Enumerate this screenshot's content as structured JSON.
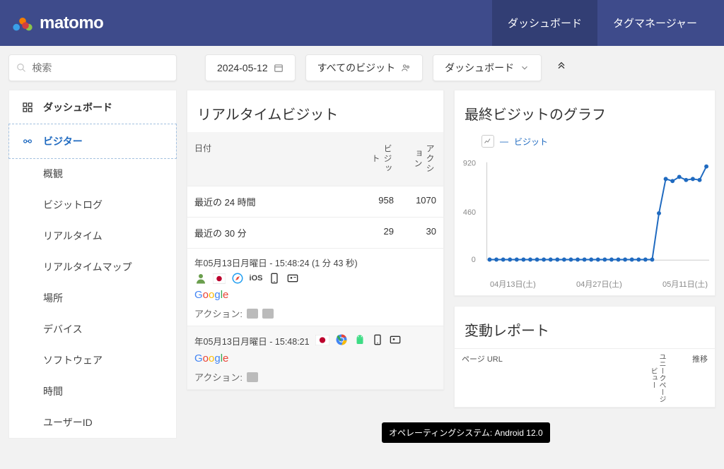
{
  "nav": {
    "logo_text": "matomo",
    "items": [
      "ダッシュボード",
      "タグマネージャー"
    ]
  },
  "toolbar": {
    "search_placeholder": "検索",
    "date": "2024-05-12",
    "segment": "すべてのビジット",
    "dashboard": "ダッシュボード"
  },
  "sidebar": {
    "dashboard": "ダッシュボード",
    "visitors": "ビジター",
    "subs": [
      "概観",
      "ビジットログ",
      "リアルタイム",
      "リアルタイムマップ",
      "場所",
      "デバイス",
      "ソフトウェア",
      "時間",
      "ユーザーID"
    ]
  },
  "realtime": {
    "title": "リアルタイムビジット",
    "col_date": "日付",
    "col_visit": "ビジット",
    "col_action": "アクション",
    "rows": [
      {
        "label": "最近の 24 時間",
        "v": "958",
        "a": "1070"
      },
      {
        "label": "最近の 30 分",
        "v": "29",
        "a": "30"
      }
    ],
    "visits": [
      {
        "dt": "年05月13日月曜日 - 15:48:24 (1 分 43 秒)",
        "os_label": "iOS",
        "ref": "Google",
        "actions_label": "アクション:",
        "icons": [
          "user",
          "flag-jp",
          "safari",
          "ios-text",
          "device",
          "id-card"
        ]
      },
      {
        "dt": "年05月13日月曜日 - 15:48:21",
        "os_label": "",
        "ref": "Google",
        "actions_label": "アクション:",
        "icons": [
          "flag-jp",
          "chrome",
          "android",
          "device",
          "id-card"
        ]
      }
    ]
  },
  "graph": {
    "title": "最終ビジットのグラフ",
    "legend": "ビジット",
    "yticks": [
      "920",
      "460",
      "0"
    ],
    "xticks": [
      "04月13日(土)",
      "04月27日(土)",
      "05月11日(土)"
    ]
  },
  "movers": {
    "title": "変動レポート",
    "col1": "ページ URL",
    "col2": "ユニークページビュー",
    "col3": "推移"
  },
  "tooltip": "オペレーティングシステム: Android 12.0",
  "chart_data": {
    "type": "line",
    "title": "最終ビジットのグラフ",
    "xlabel": "",
    "ylabel": "",
    "ylim": [
      0,
      920
    ],
    "series": [
      {
        "name": "ビジット",
        "values": [
          5,
          5,
          5,
          5,
          5,
          5,
          5,
          5,
          5,
          5,
          5,
          5,
          5,
          5,
          5,
          5,
          5,
          5,
          5,
          5,
          5,
          5,
          5,
          5,
          5,
          450,
          780,
          760,
          800,
          770,
          780,
          770,
          900
        ]
      }
    ],
    "x_tick_labels": [
      "04月13日(土)",
      "04月27日(土)",
      "05月11日(土)"
    ]
  }
}
